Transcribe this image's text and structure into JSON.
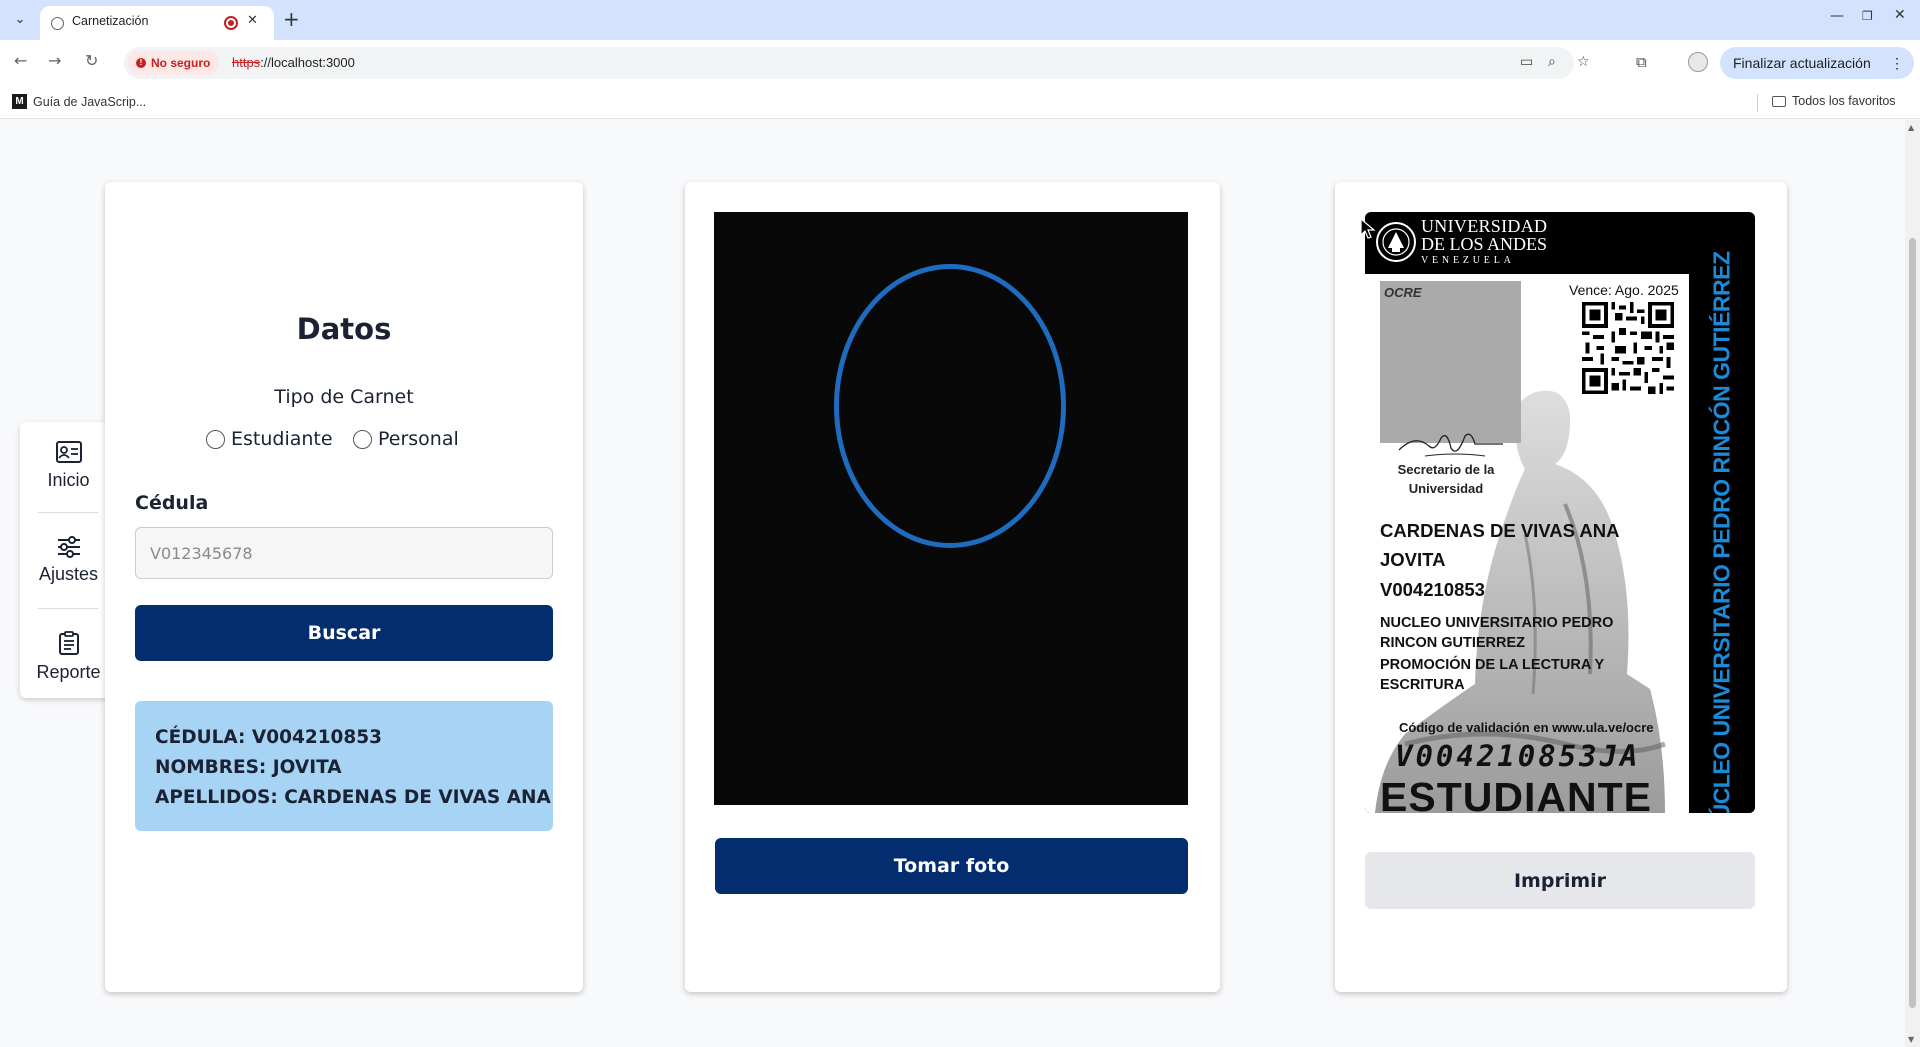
{
  "browser": {
    "tab_title": "Carnetización",
    "url_scheme": "https",
    "url_rest": "://localhost:3000",
    "security_label": "No seguro",
    "update_button": "Finalizar actualización",
    "bookmark": "Guía de JavaScrip...",
    "bookmark_icon_letter": "M",
    "all_bookmarks": "Todos los favoritos"
  },
  "sidebar": {
    "items": [
      {
        "label": "Inicio",
        "icon": "id-card-icon"
      },
      {
        "label": "Ajustes",
        "icon": "sliders-icon"
      },
      {
        "label": "Reporte",
        "icon": "clipboard-icon"
      }
    ]
  },
  "form": {
    "title": "Datos",
    "type_label": "Tipo de Carnet",
    "options": [
      "Estudiante",
      "Personal"
    ],
    "cedula_label": "Cédula",
    "cedula_placeholder": "V012345678",
    "search_button": "Buscar",
    "result": {
      "cedula": "CÉDULA: V004210853",
      "nombres": "NOMBRES: JOVITA",
      "apellidos": "APELLIDOS: CARDENAS DE VIVAS ANA"
    }
  },
  "camera": {
    "button": "Tomar foto"
  },
  "id_card": {
    "university_line1": "UNIVERSIDAD",
    "university_line2": "DE LOS ANDES",
    "university_line3": "VENEZUELA",
    "side_text": "NÚCLEO UNIVERSITARIO PEDRO RINCÓN GUTIÉRREZ",
    "photo_label": "OCRE",
    "expires": "Vence: Ago. 2025",
    "secretary_line1": "Secretario de la",
    "secretary_line2": "Universidad",
    "name_line1": "CARDENAS DE VIVAS ANA",
    "name_line2": "JOVITA",
    "id_number": "V004210853",
    "nucleus": "NUCLEO UNIVERSITARIO PEDRO RINCON GUTIERREZ",
    "program": "PROMOCIÓN DE LA LECTURA Y ESCRITURA",
    "validation": "Código de validación en www.ula.ve/ocre",
    "validation_code": "V004210853JA",
    "card_type": "ESTUDIANTE",
    "print_button": "Imprimir"
  },
  "colors": {
    "primary_button": "#032d6e",
    "info_box": "#a7d3f4",
    "oval_guide": "#1e6bbf",
    "side_text": "#1b8ad8"
  }
}
